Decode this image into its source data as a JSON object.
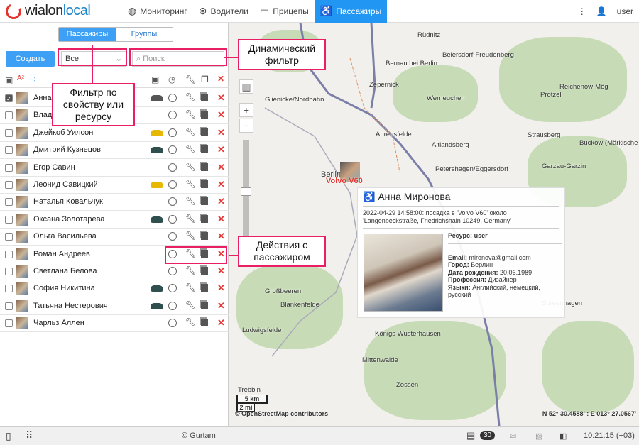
{
  "header": {
    "logo": "wialonlocal",
    "nav": [
      {
        "label": "Мониторинг",
        "icon": "globe-icon"
      },
      {
        "label": "Водители",
        "icon": "steering-wheel-icon"
      },
      {
        "label": "Прицепы",
        "icon": "trailer-icon"
      },
      {
        "label": "Пассажиры",
        "icon": "passenger-icon",
        "active": true
      }
    ],
    "user": "user"
  },
  "left": {
    "tabs": [
      "Пассажиры",
      "Группы"
    ],
    "create": "Создать",
    "filter": "Все",
    "search_placeholder": "Поиск",
    "rows": [
      {
        "name": "Анна Миронова",
        "checked": true,
        "car": "#555"
      },
      {
        "name": "Влад",
        "car": null
      },
      {
        "name": "Джейкоб Уилсон",
        "car": "#e6b800"
      },
      {
        "name": "Дмитрий Кузнецов",
        "car": "#2f4f4f"
      },
      {
        "name": "Егор Савин",
        "car": null
      },
      {
        "name": "Леонид Савицкий",
        "car": "#e6b800"
      },
      {
        "name": "Наталья Ковальчук",
        "car": null
      },
      {
        "name": "Оксана Золотарева",
        "car": "#2f4f4f"
      },
      {
        "name": "Ольга Васильева",
        "car": null
      },
      {
        "name": "Роман Андреев",
        "car": null
      },
      {
        "name": "Светлана Белова",
        "car": null
      },
      {
        "name": "София Никитина",
        "car": "#2f4f4f"
      },
      {
        "name": "Татьяна Нестерович",
        "car": "#2f4f4f"
      },
      {
        "name": "Чарльз Аллен",
        "car": null
      }
    ]
  },
  "callouts": {
    "filter": "Фильтр по свойству или ресурсу",
    "dynamic": "Динамический фильтр",
    "actions": "Действия с пассажиром"
  },
  "map": {
    "labels": [
      "Rüdnitz",
      "Beiersdorf-Freudenberg",
      "Bernau bei Berlin",
      "Zepernick",
      "Glienicke/Nordbahn",
      "Werneuchen",
      "Protzel",
      "Reichenow-Mög",
      "Ahrensfelde",
      "Altlandsberg",
      "Strausberg",
      "Buckow (Märkische",
      "Garzau-Garzin",
      "Petershagen/Eggersdorf",
      "Berlin",
      "Großbeeren",
      "Blankenfelde",
      "Ludwigsfelde",
      "Königs Wusterhausen",
      "Mittenwalde",
      "Trebbin",
      "Zossen",
      "Spreenhagen"
    ],
    "unit_label": "Volvo V60",
    "scale_km": "5 km",
    "scale_mi": "2 mi",
    "attribution": "© OpenStreetMap contributors",
    "coords": "N 52° 30.4588' : E 013° 27.0567'"
  },
  "popup": {
    "title": "Анна Миронова",
    "event": "2022-04-29 14:58:00: посадка в 'Volvo V60' около 'Langenbeckstraße, Friedrichshain 10249, Germany'",
    "resource_label": "Ресурс:",
    "resource": "user",
    "email_label": "Email:",
    "email": "mironova@gmail.com",
    "city_label": "Город:",
    "city": "Берлин",
    "dob_label": "Дата рождения:",
    "dob": "20.06.1989",
    "job_label": "Профессия:",
    "job": "Дизайнер",
    "lang_label": "Языки:",
    "lang": "Английский, немецкий, русский"
  },
  "bottom": {
    "copyright": "© Gurtam",
    "count": "30",
    "time": "10:21:15 (+03)"
  }
}
